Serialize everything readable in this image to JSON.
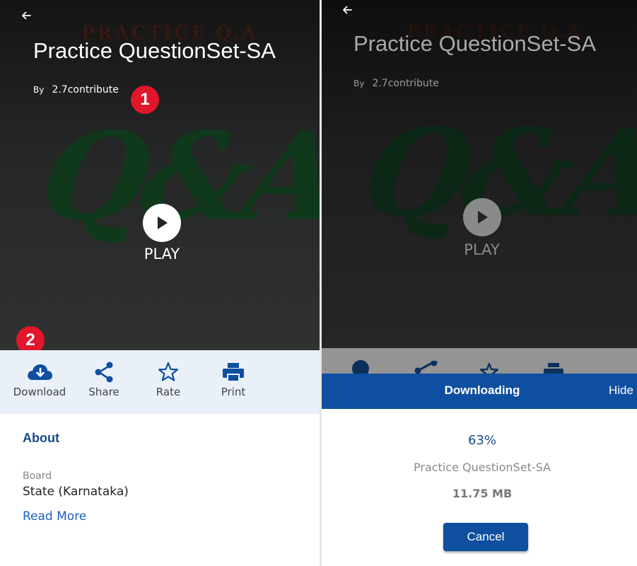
{
  "content": {
    "title": "Practice QuestionSet-SA",
    "by_label": "By",
    "author": "2.7contribute",
    "play_label": "PLAY",
    "cover_art": {
      "title_text": "PRACTICE Q.A",
      "big_text": "Q&A"
    }
  },
  "badges": [
    "1",
    "2"
  ],
  "actions": [
    {
      "label": "Download",
      "icon": "cloud-download-icon"
    },
    {
      "label": "Share",
      "icon": "share-icon"
    },
    {
      "label": "Rate",
      "icon": "star-icon"
    },
    {
      "label": "Print",
      "icon": "print-icon"
    }
  ],
  "about": {
    "title": "About",
    "board_label": "Board",
    "board_value": "State (Karnataka)",
    "read_more": "Read More"
  },
  "download_dialog": {
    "title": "Downloading",
    "hide_label": "Hide",
    "percent_text": "63%",
    "progress": 0.63,
    "content_name": "Practice QuestionSet-SA",
    "size": "11.75 MB",
    "cancel_label": "Cancel"
  },
  "colors": {
    "primary": "#0e4fa0",
    "link": "#1b5fc1",
    "badge": "#e1162b",
    "action_bar_bg": "#e9f0f8"
  }
}
